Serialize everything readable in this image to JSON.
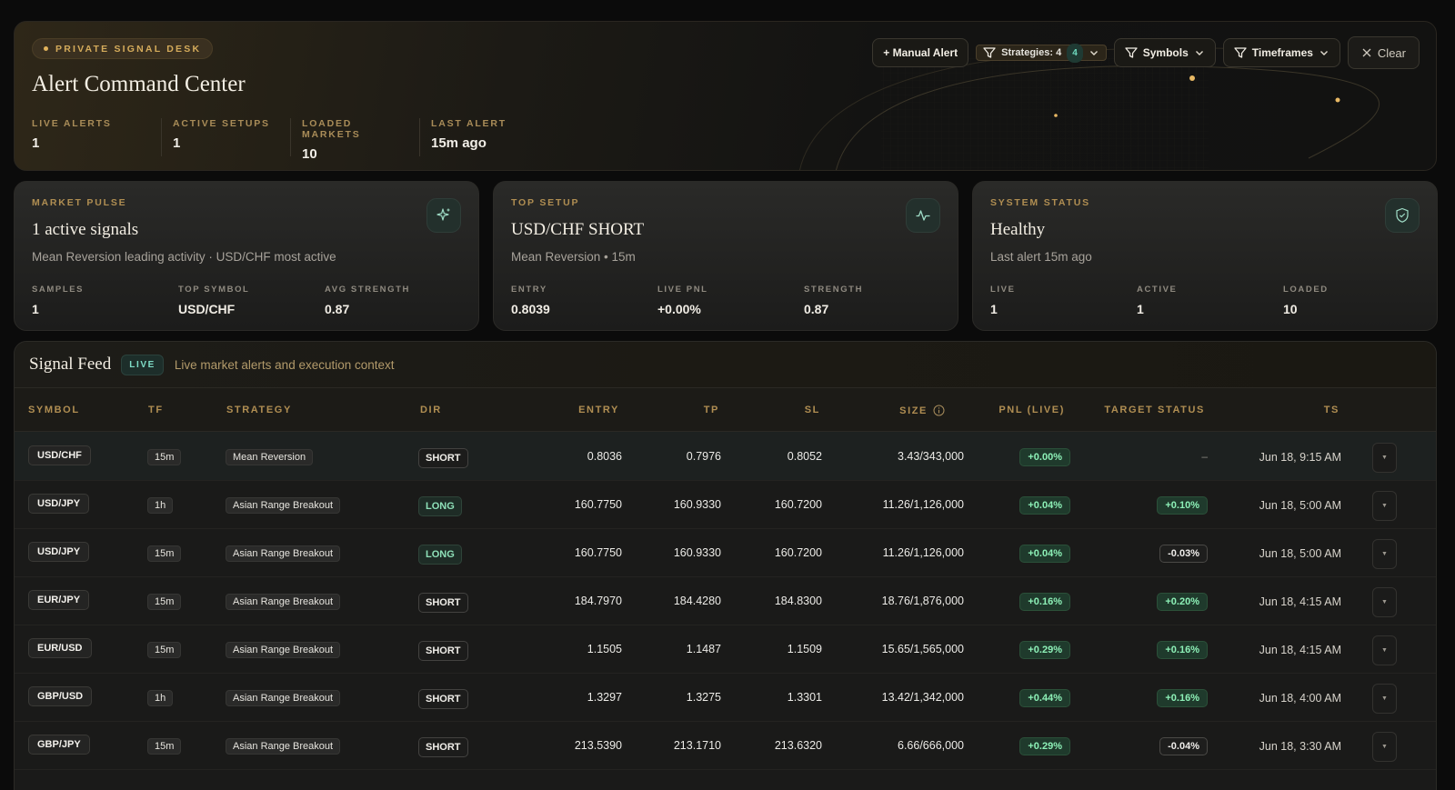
{
  "hero": {
    "badge": "PRIVATE SIGNAL DESK",
    "title": "Alert Command Center",
    "stats": [
      {
        "label": "LIVE ALERTS",
        "value": "1"
      },
      {
        "label": "ACTIVE SETUPS",
        "value": "1"
      },
      {
        "label": "LOADED MARKETS",
        "value": "10"
      },
      {
        "label": "LAST ALERT",
        "value": "15m ago"
      }
    ]
  },
  "toolbar": {
    "manual_alert": "+ Manual Alert",
    "strategies": "Strategies: 4",
    "strategies_count": "4",
    "symbols": "Symbols",
    "timeframes": "Timeframes",
    "clear": "Clear"
  },
  "cards": {
    "market_pulse": {
      "eyebrow": "MARKET PULSE",
      "title": "1 active signals",
      "subtitle": "Mean Reversion leading activity · USD/CHF most active",
      "icon": "sparkle-icon",
      "stats": [
        {
          "label": "SAMPLES",
          "value": "1"
        },
        {
          "label": "TOP SYMBOL",
          "value": "USD/CHF"
        },
        {
          "label": "AVG STRENGTH",
          "value": "0.87"
        }
      ]
    },
    "top_setup": {
      "eyebrow": "TOP SETUP",
      "title": "USD/CHF SHORT",
      "subtitle": "Mean Reversion • 15m",
      "icon": "pulse-icon",
      "stats": [
        {
          "label": "ENTRY",
          "value": "0.8039"
        },
        {
          "label": "LIVE PNL",
          "value": "+0.00%"
        },
        {
          "label": "STRENGTH",
          "value": "0.87"
        }
      ]
    },
    "system_status": {
      "eyebrow": "SYSTEM STATUS",
      "title": "Healthy",
      "subtitle": "Last alert 15m ago",
      "icon": "shield-check-icon",
      "stats": [
        {
          "label": "LIVE",
          "value": "1"
        },
        {
          "label": "ACTIVE",
          "value": "1"
        },
        {
          "label": "LOADED",
          "value": "10"
        }
      ]
    }
  },
  "feed": {
    "title": "Signal Feed",
    "live_chip": "LIVE",
    "description": "Live market alerts and execution context",
    "columns": {
      "symbol": "SYMBOL",
      "tf": "TF",
      "strategy": "STRATEGY",
      "dir": "DIR",
      "entry": "ENTRY",
      "tp": "TP",
      "sl": "SL",
      "size": "SIZE",
      "pnl": "PNL (LIVE)",
      "target": "TARGET STATUS",
      "ts": "TS"
    },
    "rows": [
      {
        "symbol": "USD/CHF",
        "tf": "15m",
        "strategy": "Mean Reversion",
        "dir": "SHORT",
        "entry": "0.8036",
        "tp": "0.7976",
        "sl": "0.8052",
        "size": "3.43/343,000",
        "pnl": "+0.00%",
        "target": "–",
        "ts": "Jun 18, 9:15 AM"
      },
      {
        "symbol": "USD/JPY",
        "tf": "1h",
        "strategy": "Asian Range Breakout",
        "dir": "LONG",
        "entry": "160.7750",
        "tp": "160.9330",
        "sl": "160.7200",
        "size": "11.26/1,126,000",
        "pnl": "+0.04%",
        "target": "+0.10%",
        "ts": "Jun 18, 5:00 AM"
      },
      {
        "symbol": "USD/JPY",
        "tf": "15m",
        "strategy": "Asian Range Breakout",
        "dir": "LONG",
        "entry": "160.7750",
        "tp": "160.9330",
        "sl": "160.7200",
        "size": "11.26/1,126,000",
        "pnl": "+0.04%",
        "target": "-0.03%",
        "ts": "Jun 18, 5:00 AM"
      },
      {
        "symbol": "EUR/JPY",
        "tf": "15m",
        "strategy": "Asian Range Breakout",
        "dir": "SHORT",
        "entry": "184.7970",
        "tp": "184.4280",
        "sl": "184.8300",
        "size": "18.76/1,876,000",
        "pnl": "+0.16%",
        "target": "+0.20%",
        "ts": "Jun 18, 4:15 AM"
      },
      {
        "symbol": "EUR/USD",
        "tf": "15m",
        "strategy": "Asian Range Breakout",
        "dir": "SHORT",
        "entry": "1.1505",
        "tp": "1.1487",
        "sl": "1.1509",
        "size": "15.65/1,565,000",
        "pnl": "+0.29%",
        "target": "+0.16%",
        "ts": "Jun 18, 4:15 AM"
      },
      {
        "symbol": "GBP/USD",
        "tf": "1h",
        "strategy": "Asian Range Breakout",
        "dir": "SHORT",
        "entry": "1.3297",
        "tp": "1.3275",
        "sl": "1.3301",
        "size": "13.42/1,342,000",
        "pnl": "+0.44%",
        "target": "+0.16%",
        "ts": "Jun 18, 4:00 AM"
      },
      {
        "symbol": "GBP/JPY",
        "tf": "15m",
        "strategy": "Asian Range Breakout",
        "dir": "SHORT",
        "entry": "213.5390",
        "tp": "213.1710",
        "sl": "213.6320",
        "size": "6.66/666,000",
        "pnl": "+0.29%",
        "target": "-0.04%",
        "ts": "Jun 18, 3:30 AM"
      }
    ]
  }
}
